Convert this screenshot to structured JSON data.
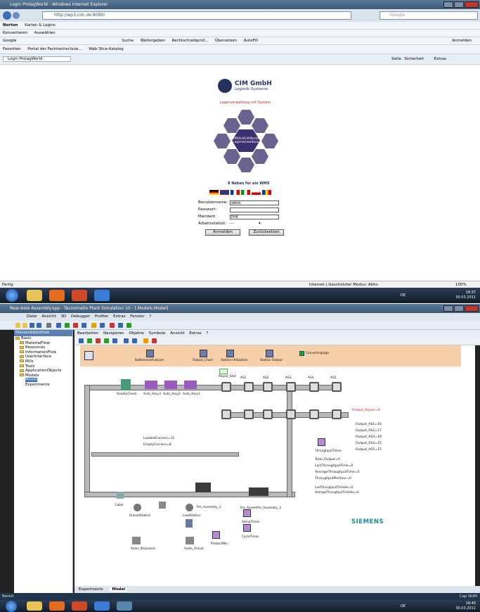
{
  "shot1": {
    "window_title": "Login ProlagWorld - Windows Internet Explorer",
    "url": "http://wp3.cim.de:8080/",
    "search_placeholder": "Google",
    "norton": "Norton",
    "norton_card": "Karten & Logins",
    "konvertieren": "Konvertieren",
    "auswaehlen": "Auswählen",
    "google_label": "Google",
    "google_items": [
      "Suche",
      "Weitergeben",
      "Rechtschreibprüf...",
      "Übersetzen",
      "AutoFill"
    ],
    "anmelden": "Anmelden",
    "favoriten": "Favoriten",
    "fav_links": [
      "Portal der Fachhochschule...",
      "Web Slice-Katalog"
    ],
    "tab_title": "Login ProlagWorld",
    "cmd_items": [
      "Seite",
      "Sicherheit",
      "Extras"
    ],
    "logo_text": "CIM GmbH",
    "logo_sub": "Logistik-Systeme",
    "slogan": "Lagerverwaltung mit System",
    "hex_center": "PROLAG®World Lagerverwaltung",
    "wms_text": "8 Naben für ein WMS",
    "form": {
      "user_label": "Benutzername:",
      "user_value": "admin",
      "pass_label": "Passwort:",
      "mandant_label": "Mandant:",
      "mandant_value": "FHK",
      "arbeitsstation_label": "Arbeitsstation:",
      "arbeitsstation_value": "---",
      "login_btn": "Anmelden",
      "reset_btn": "Zurücksetzen"
    },
    "status_left": "Fertig",
    "status_zone": "Internet | Geschützter Modus: Aktiv",
    "zoom": "100%",
    "clock_time": "18:37",
    "clock_date": "30.03.2011",
    "lang": "DE"
  },
  "shot2": {
    "window_title": "Rear-Axle Assembly.spp - Tecnomatix Plant Simulation 10 - [.Models.Model]",
    "menu": [
      "Datei",
      "Ansicht",
      "3D",
      "Debugger",
      "Profiler",
      "Extras",
      "Fenster",
      "?"
    ],
    "lib_title": "Klassenbibliothek",
    "tree": [
      "Basis",
      "MaterialFlow",
      "Resources",
      "InformationFlow",
      "UserInterface",
      "MUs",
      "Tools",
      "ApplicationObjects",
      "Models",
      "Model",
      "Experiments"
    ],
    "model_menu": [
      "Bearbeiten",
      "Navigieren",
      "Objekte",
      "Symbole",
      "Ansicht",
      "Extras",
      "?"
    ],
    "header_objects": [
      "BottleneckAnalyzer",
      "Output_Chart",
      "Station-Utilization",
      "Station-Output"
    ],
    "event_ctrl": "EventController",
    "convert_label": "Convertinglogic",
    "stations": [
      "QualityCheck",
      "Auto_Assy3",
      "Auto_Assy2",
      "Auto_Assy1"
    ],
    "repair": "Repair_Stat",
    "asy_labels": [
      "AS1",
      "AS2",
      "AS3",
      "AS4",
      "AS5"
    ],
    "loaded": "LoadedCarriers=31",
    "empty": "EmptyCarriers=8",
    "output_repair": "Output_Repair=0",
    "outputs": [
      "Output_AS1=16",
      "Output_AS2=17",
      "Output_AS3=19",
      "Output_AS4=15",
      "Output_AS5=15"
    ],
    "throughput_times": "ThroughputTimes",
    "totals": [
      "Total_Output=0",
      "LastThroughputTime=0",
      "AverageThroughputTime=0",
      "ThroughputPerHour=0"
    ],
    "last_tt": "LastThroughputTimeSec=0",
    "avg_tt": "AverageThroughputTimeSec=0",
    "pre_assy2": "Pre_Assembly_2",
    "pre_assy1": "Pre_AssemPre_Assembly_3",
    "label": "Label",
    "setup": "SetupTimes",
    "cycle": "CycleTimes",
    "unload": "UnloadStation",
    "load": "LoadStation",
    "axles_ship": "Axles_Shipment",
    "axles_arr": "Axles_Arrival",
    "productmix": "ProductMix",
    "siemens": "SIEMENS",
    "tabs": [
      "Experiments",
      "Model"
    ],
    "status_left": "Bereit",
    "status_right": "Cap NUM",
    "clock_time": "18:40",
    "clock_date": "30.03.2011",
    "lang": "DE"
  }
}
